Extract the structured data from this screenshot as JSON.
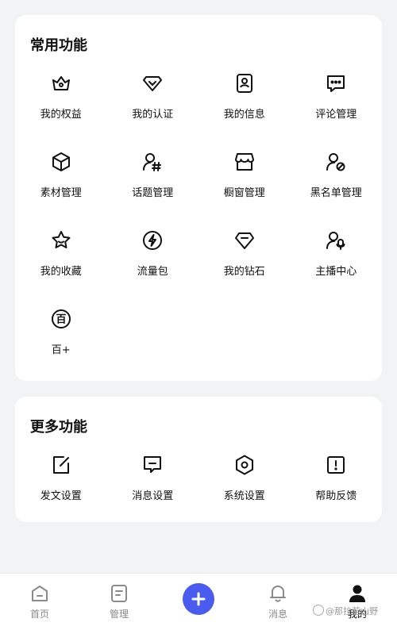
{
  "common": {
    "title": "常用功能",
    "items": [
      {
        "label": "我的权益",
        "icon": "crown-icon"
      },
      {
        "label": "我的认证",
        "icon": "badge-check-icon"
      },
      {
        "label": "我的信息",
        "icon": "profile-card-icon"
      },
      {
        "label": "评论管理",
        "icon": "comment-icon"
      },
      {
        "label": "素材管理",
        "icon": "cube-icon"
      },
      {
        "label": "话题管理",
        "icon": "user-hashtag-icon"
      },
      {
        "label": "橱窗管理",
        "icon": "storefront-icon"
      },
      {
        "label": "黑名单管理",
        "icon": "user-block-icon"
      },
      {
        "label": "我的收藏",
        "icon": "star-icon"
      },
      {
        "label": "流量包",
        "icon": "lightning-icon"
      },
      {
        "label": "我的钻石",
        "icon": "diamond-icon"
      },
      {
        "label": "主播中心",
        "icon": "user-mic-icon"
      },
      {
        "label": "百+",
        "icon": "bai-circle-icon"
      }
    ]
  },
  "more": {
    "title": "更多功能",
    "items": [
      {
        "label": "发文设置",
        "icon": "edit-icon"
      },
      {
        "label": "消息设置",
        "icon": "message-icon"
      },
      {
        "label": "系统设置",
        "icon": "settings-hex-icon"
      },
      {
        "label": "帮助反馈",
        "icon": "alert-square-icon"
      }
    ]
  },
  "nav": {
    "home": "首页",
    "manage": "管理",
    "messages": "消息",
    "mine": "我的"
  },
  "bai_glyph": "百",
  "watermark": "@那拉若山野",
  "colors": {
    "accent": "#4a5cf0",
    "background": "#f2f3f5"
  }
}
